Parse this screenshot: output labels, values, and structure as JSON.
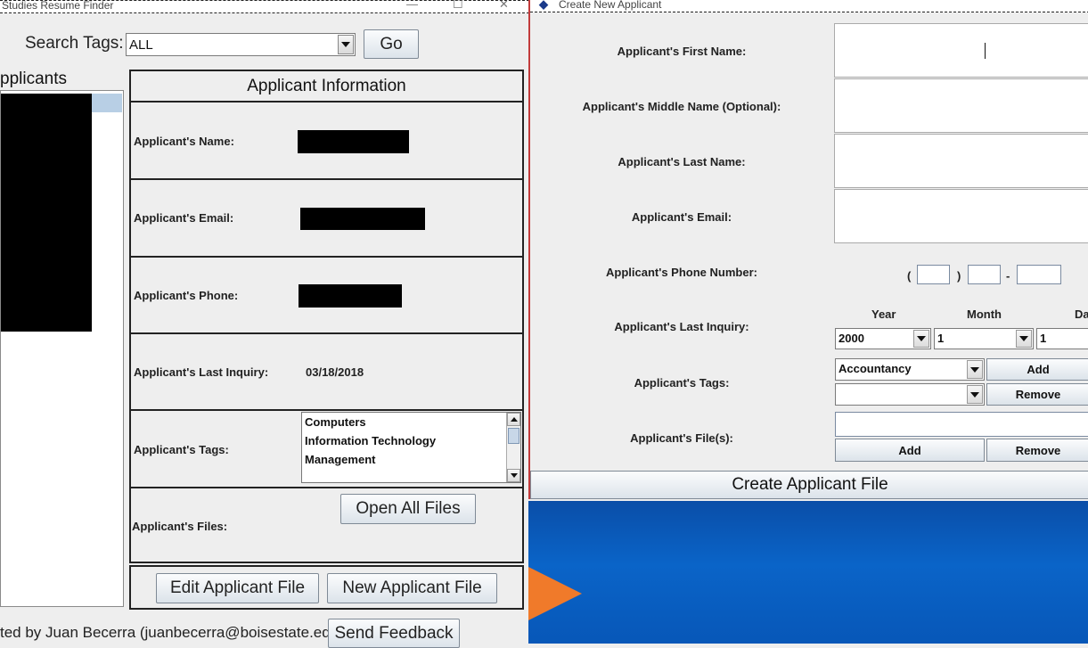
{
  "main_window": {
    "title": "Studies Resume Finder",
    "controls": {
      "minimize": "—",
      "maximize": "☐",
      "close": "✕"
    }
  },
  "search": {
    "label": "Search Tags:",
    "value": "ALL",
    "go_label": "Go"
  },
  "applicants_panel": {
    "heading": "pplicants"
  },
  "info": {
    "header": "Applicant Information",
    "name_label": "Applicant's Name:",
    "email_label": "Applicant's Email:",
    "phone_label": "Applicant's Phone:",
    "last_inquiry_label": "Applicant's Last Inquiry:",
    "last_inquiry_value": "03/18/2018",
    "tags_label": "Applicant's Tags:",
    "tags": [
      "Computers",
      "Information Technology",
      "Management"
    ],
    "files_label": "Applicant's Files:",
    "open_all_files_label": "Open All Files"
  },
  "actions": {
    "edit_label": "Edit Applicant File",
    "new_label": "New Applicant File"
  },
  "footer": {
    "text": "ted by Juan Becerra (juanbecerra@boisestate.edu)",
    "send_feedback_label": "Send Feedback"
  },
  "create_window": {
    "title": "Create New Applicant",
    "first_name_label": "Applicant's First Name:",
    "middle_name_label": "Applicant's Middle Name (Optional):",
    "last_name_label": "Applicant's Last Name:",
    "email_label": "Applicant's Email:",
    "phone_label": "Applicant's Phone Number:",
    "phone_open_paren": "(",
    "phone_close_paren": ")",
    "phone_dash": "-",
    "last_inquiry_label": "Applicant's Last Inquiry:",
    "year_heading": "Year",
    "month_heading": "Month",
    "day_heading": "Da",
    "year_value": "2000",
    "month_value": "1",
    "day_value": "1",
    "tags_label": "Applicant's Tags:",
    "tag_combo_value": "Accountancy",
    "tag_combo2_value": "",
    "tag_add_label": "Add",
    "tag_remove_label": "Remove",
    "files_label": "Applicant's File(s):",
    "file_add_label": "Add",
    "file_remove_label": "Remove",
    "create_label": "Create Applicant File"
  }
}
